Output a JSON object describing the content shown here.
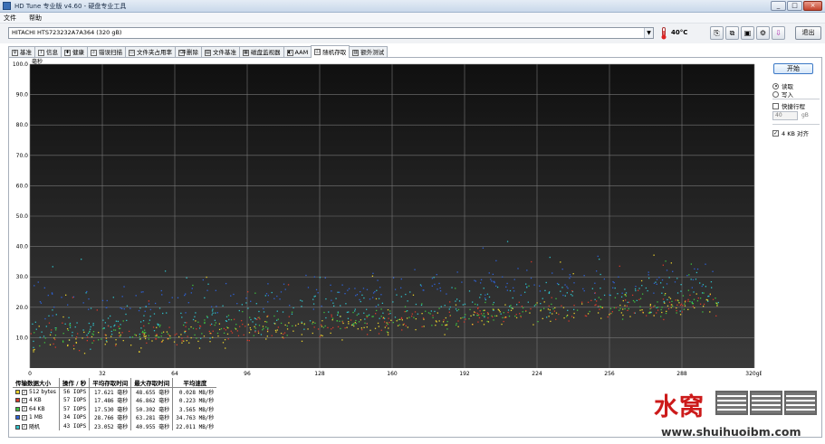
{
  "window": {
    "title": "HD Tune 专业版 v4.60 - 硬盘专业工具",
    "controls": [
      "_",
      "□",
      "×"
    ]
  },
  "menu": {
    "file": "文件",
    "help": "帮助"
  },
  "toolbar": {
    "drive": "HITACHI HTS723232A7A364 (320 gB)",
    "temperature": "40°C",
    "exit_label": "退出",
    "icons": [
      "copy-text-icon",
      "copy-image-icon",
      "save-icon",
      "options-icon",
      "download-icon"
    ]
  },
  "tabs": [
    {
      "label": "基准",
      "icon": "benchmark-icon"
    },
    {
      "label": "信息",
      "icon": "info-icon"
    },
    {
      "label": "健康",
      "icon": "health-icon"
    },
    {
      "label": "错误扫描",
      "icon": "error-scan-icon"
    },
    {
      "label": "文件夹占用率",
      "icon": "folder-icon"
    },
    {
      "label": "删除",
      "icon": "erase-icon"
    },
    {
      "label": "文件基准",
      "icon": "file-benchmark-icon"
    },
    {
      "label": "磁盘监视器",
      "icon": "monitor-icon"
    },
    {
      "label": "AAM",
      "icon": "aam-icon"
    },
    {
      "label": "随机存取",
      "icon": "random-access-icon",
      "active": true
    },
    {
      "label": "额外测试",
      "icon": "extra-tests-icon"
    }
  ],
  "side": {
    "start_label": "开始",
    "read_label": "读取",
    "write_label": "写入",
    "read_selected": true,
    "short_stroke_label": "快捷行程",
    "short_stroke_checked": false,
    "short_stroke_value": "40",
    "short_stroke_unit": "gB",
    "align_label": "4 KB 对齐",
    "align_checked": true
  },
  "chart_data": {
    "type": "scatter",
    "ylabel": "毫秒",
    "xunit": "gB",
    "ylim": [
      0,
      100
    ],
    "xlim": [
      0,
      320
    ],
    "y_ticks": [
      "100.0",
      "90.0",
      "80.0",
      "70.0",
      "60.0",
      "50.0",
      "40.0",
      "30.0",
      "20.0",
      "10.0"
    ],
    "x_ticks": [
      "0",
      "32",
      "64",
      "96",
      "128",
      "160",
      "192",
      "224",
      "256",
      "288",
      "320gB"
    ],
    "grid": true,
    "background": "#202020",
    "series": [
      {
        "name": "512 bytes",
        "color": "#e8cf2c",
        "trend": {
          "start": 8,
          "end": 22
        },
        "spread": 6,
        "count": 260
      },
      {
        "name": "4 KB",
        "color": "#d83a2a",
        "trend": {
          "start": 9,
          "end": 23
        },
        "spread": 6,
        "count": 220
      },
      {
        "name": "64 KB",
        "color": "#3ec23e",
        "trend": {
          "start": 10,
          "end": 23
        },
        "spread": 6,
        "count": 240
      },
      {
        "name": "1 MB",
        "color": "#2f62d6",
        "trend": {
          "start": 21,
          "end": 31
        },
        "spread": 7,
        "count": 200
      },
      {
        "name": "随机",
        "color": "#2fc0c8",
        "trend": {
          "start": 13,
          "end": 27
        },
        "spread": 9,
        "count": 300
      }
    ]
  },
  "results": {
    "headers": [
      "传输数据大小",
      "操作 / 秒",
      "平均存取时间",
      "最大存取时间",
      "平均速度"
    ],
    "rows": [
      {
        "label": "512 bytes",
        "color": "#e8cf2c",
        "ops": "56 IOPS",
        "avg": "17.621 毫秒",
        "max": "48.655 毫秒",
        "speed": "0.028 MB/秒"
      },
      {
        "label": "4 KB",
        "color": "#d83a2a",
        "ops": "57 IOPS",
        "avg": "17.486 毫秒",
        "max": "46.862 毫秒",
        "speed": "0.223 MB/秒"
      },
      {
        "label": "64 KB",
        "color": "#3ec23e",
        "ops": "57 IOPS",
        "avg": "17.530 毫秒",
        "max": "50.302 毫秒",
        "speed": "3.565 MB/秒"
      },
      {
        "label": "1 MB",
        "color": "#2f62d6",
        "ops": "34 IOPS",
        "avg": "28.766 毫秒",
        "max": "63.281 毫秒",
        "speed": "34.763 MB/秒"
      },
      {
        "label": "随机",
        "color": "#2fc0c8",
        "ops": "43 IOPS",
        "avg": "23.052 毫秒",
        "max": "40.955 毫秒",
        "speed": "22.011 MB/秒"
      }
    ]
  },
  "watermark": {
    "title": "水窝",
    "url": "www.shuihuoibm.com"
  }
}
